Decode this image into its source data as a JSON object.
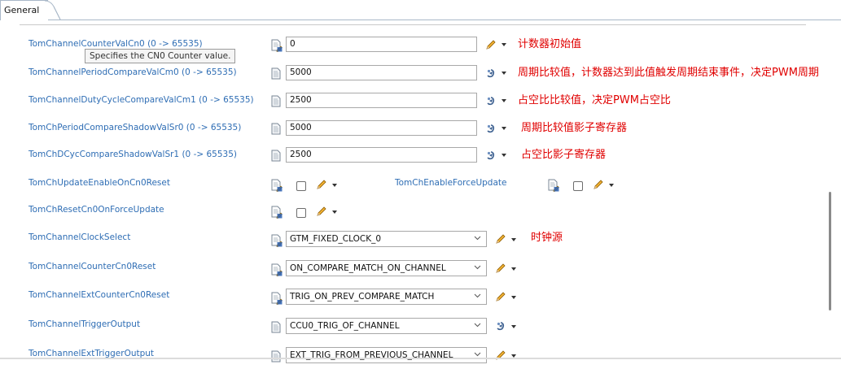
{
  "tab": {
    "label": "General"
  },
  "tooltip": "Specifies the CN0 Counter value.",
  "rows": [
    {
      "label": "TomChannelCounterValCn0 (0 -> 65535)",
      "value": "0",
      "note": "计数器初始值"
    },
    {
      "label": "TomChannelPeriodCompareValCm0 (0 -> 65535)",
      "value": "5000",
      "note": "周期比较值，计数器达到此值触发周期结束事件，决定PWM周期"
    },
    {
      "label": "TomChannelDutyCycleCompareValCm1 (0 -> 65535)",
      "value": "2500",
      "note": "占空比比较值，决定PWM占空比"
    },
    {
      "label": "TomChPeriodCompareShadowValSr0 (0 -> 65535)",
      "value": "5000",
      "note": "周期比较值影子寄存器"
    },
    {
      "label": "TomChDCycCompareShadowValSr1 (0 -> 65535)",
      "value": "2500",
      "note": "占空比影子寄存器"
    }
  ],
  "checks": [
    {
      "label": "TomChUpdateEnableOnCn0Reset",
      "checked": false
    },
    {
      "label": "TomChEnableForceUpdate",
      "checked": false
    },
    {
      "label": "TomChResetCn0OnForceUpdate",
      "checked": false
    }
  ],
  "combos": [
    {
      "label": "TomChannelClockSelect",
      "value": "GTM_FIXED_CLOCK_0",
      "note": "时钟源"
    },
    {
      "label": "TomChannelCounterCn0Reset",
      "value": "ON_COMPARE_MATCH_ON_CHANNEL"
    },
    {
      "label": "TomChannelExtCounterCn0Reset",
      "value": "TRIG_ON_PREV_COMPARE_MATCH"
    },
    {
      "label": "TomChannelTriggerOutput",
      "value": "CCU0_TRIG_OF_CHANNEL"
    },
    {
      "label": "TomChannelExtTriggerOutput",
      "value": "EXT_TRIG_FROM_PREVIOUS_CHANNEL"
    }
  ],
  "icons": {
    "doc_edit": "document-pencil-icon",
    "doc": "document-icon",
    "pen": "pencil-icon",
    "fx": "calculated-value-icon",
    "dropdown": "caret-down-icon",
    "chevron": "chevron-down-icon"
  },
  "colors": {
    "label": "#2e6db4",
    "note": "#e00000",
    "border": "#a8a8a8"
  }
}
